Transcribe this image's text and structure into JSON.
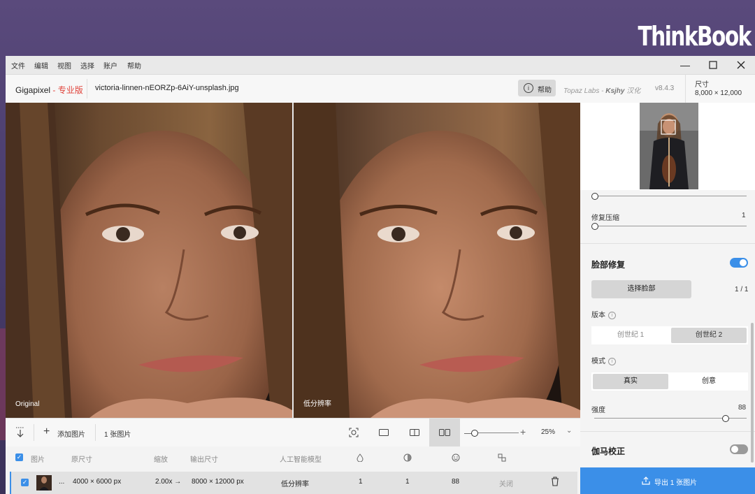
{
  "brand": "ThinkBook",
  "menubar": {
    "items": [
      "文件",
      "编辑",
      "视图",
      "选择",
      "账户",
      "帮助"
    ]
  },
  "header": {
    "app_name": "Gigapixel",
    "app_edition": "- 专业版",
    "filename": "victoria-linnen-nEORZp-6AiY-unsplash.jpg",
    "help_label": "帮助",
    "credit_prefix": "Topaz Labs - ",
    "credit_name": "Ksjhy",
    "credit_suffix": " 汉化",
    "version": "v8.4.3",
    "size_label": "尺寸",
    "size_value": "8,000 × 12,000"
  },
  "viewer": {
    "left_label": "Original",
    "right_label": "低分辨率"
  },
  "sidebar": {
    "compression_label": "修复压缩",
    "compression_value": "1",
    "face_title": "脸部修复",
    "select_face_label": "选择脸部",
    "face_count": "1 / 1",
    "version_label": "版本",
    "version_options": [
      "创世纪 1",
      "创世纪 2"
    ],
    "mode_label": "模式",
    "mode_options": [
      "真实",
      "创意"
    ],
    "strength_label": "强度",
    "strength_value": "88",
    "gamma_title": "伽马校正",
    "export_label": "导出 1 张图片"
  },
  "toolbar": {
    "add_label": "添加图片",
    "count_label": "1 张图片",
    "zoom": "25%"
  },
  "table": {
    "headers": {
      "image": "图片",
      "orig_size": "原尺寸",
      "scale": "缩放",
      "out_size": "输出尺寸",
      "ai_model": "人工智能模型"
    },
    "row": {
      "ellipsis": "...",
      "orig_size": "4000 × 6000 px",
      "scale": "2.00x →",
      "out_size": "8000 × 12000 px",
      "model": "低分辨率",
      "v1": "1",
      "v2": "1",
      "v3": "88",
      "status": "关闭"
    }
  },
  "colors": {
    "accent": "#3b8fe8",
    "edition": "#e0433b"
  },
  "slider_levels": {
    "top": 0,
    "compression": 0,
    "strength": 0.92
  }
}
